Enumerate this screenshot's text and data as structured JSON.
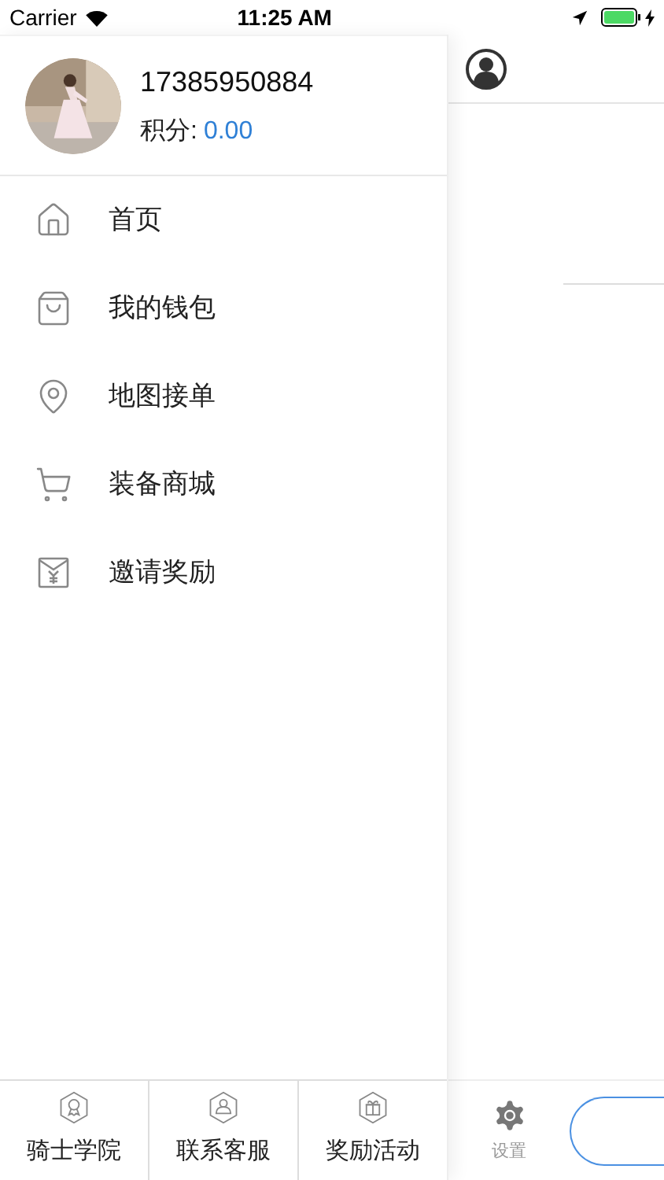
{
  "status_bar": {
    "carrier": "Carrier",
    "time": "11:25 AM"
  },
  "profile": {
    "phone": "17385950884",
    "points_label": "积分:",
    "points_value": "0.00"
  },
  "menu": [
    {
      "label": "首页"
    },
    {
      "label": "我的钱包"
    },
    {
      "label": "地图接单"
    },
    {
      "label": "装备商城"
    },
    {
      "label": "邀请奖励"
    }
  ],
  "bottom_tabs": [
    {
      "label": "骑士学院"
    },
    {
      "label": "联系客服"
    },
    {
      "label": "奖励活动"
    }
  ],
  "main_panel": {
    "settings_label": "设置"
  }
}
